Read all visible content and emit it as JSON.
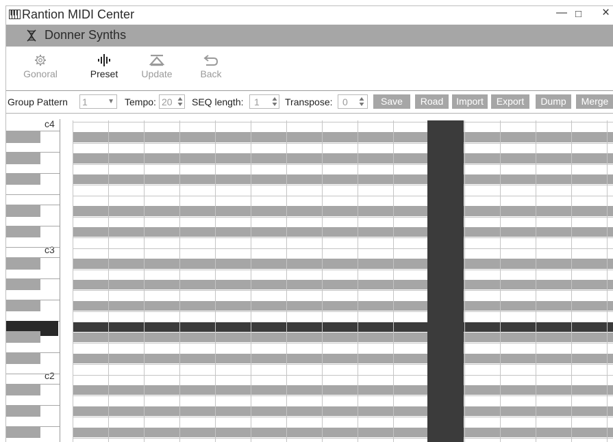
{
  "window": {
    "title": "Rantion MIDI Center",
    "minimize": "—",
    "maximize": "□",
    "close": "×"
  },
  "device": {
    "name": "Donner Synths",
    "icon": "dna-helix-icon"
  },
  "toolbar": {
    "general_label": "Gonoral",
    "preset_label": "Preset",
    "update_label": "Update",
    "back_label": "Back"
  },
  "controls": {
    "group_pattern_label": "Group Pattern",
    "group_pattern_value": "1",
    "tempo_label": "Tempo:",
    "tempo_value": "20",
    "seq_length_label": "SEQ length:",
    "seq_length_value": "1",
    "transpose_label": "Transpose:",
    "transpose_value": "0",
    "save_label": "Save",
    "road_label": "Road",
    "import_label": "Import",
    "export_label": "Export",
    "dump_label": "Dump",
    "merge_label": "Merge"
  },
  "piano": {
    "octaves": [
      "c4",
      "c3",
      "c2"
    ]
  },
  "colors": {
    "accent_gray": "#a6a6a6",
    "dark": "#3b3b3b",
    "selected_key": "#282828"
  }
}
